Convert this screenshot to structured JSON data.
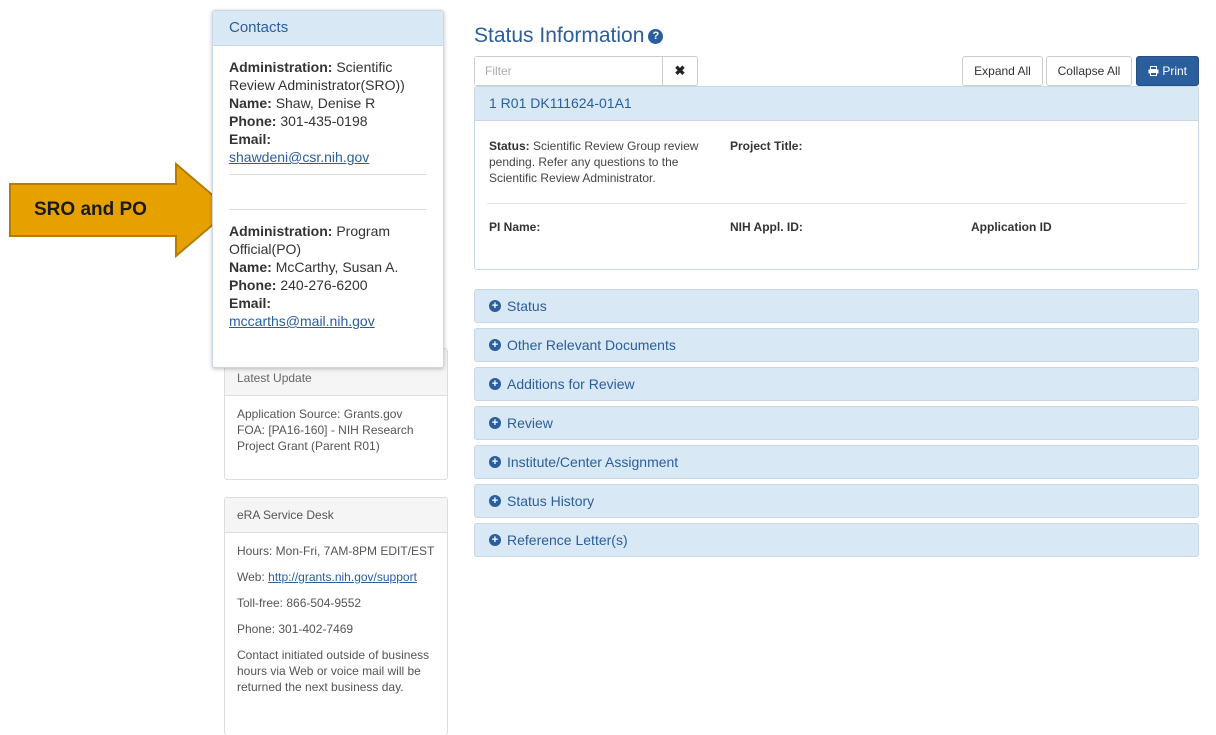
{
  "callout": {
    "label": "SRO and PO",
    "color": "#e6a100"
  },
  "contacts": {
    "title": "Contacts",
    "sro": {
      "admin_label": "Administration:",
      "admin_value": "Scientific Review Administrator(SRO))",
      "name_label": "Name:",
      "name_value": "Shaw, Denise R",
      "phone_label": "Phone:",
      "phone_value": "301-435-0198",
      "email_label": "Email:",
      "email_value": "shawdeni@csr.nih.gov"
    },
    "po": {
      "admin_label": "Administration:",
      "admin_value": "Program Official(PO)",
      "name_label": "Name:",
      "name_value": "McCarthy, Susan A.",
      "phone_label": "Phone:",
      "phone_value": "240-276-6200",
      "email_label": "Email:",
      "email_value": "mccarths@mail.nih.gov"
    }
  },
  "latest_update": {
    "title": "Latest Update",
    "source": "Application Source: Grants.gov",
    "foa": "FOA: [PA16-160] -  NIH Research Project Grant (Parent R01)"
  },
  "service_desk": {
    "title": "eRA Service Desk",
    "hours": "Hours: Mon-Fri, 7AM-8PM EDIT/EST",
    "web_label": "Web:",
    "web_link": "http://grants.nih.gov/support",
    "toll_free": "Toll-free: 866-504-9552",
    "phone": "Phone: 301-402-7469",
    "note": "Contact initiated outside of business hours via Web or voice mail will be returned the next business day."
  },
  "main": {
    "title": "Status Information",
    "filter_placeholder": "Filter",
    "clear_glyph": "✖",
    "expand_all": "Expand All",
    "collapse_all": "Collapse All",
    "print": "Print",
    "application": {
      "id": "1 R01 DK111624-01A1",
      "status_label": "Status:",
      "status_value": "Scientific Review Group review pending. Refer any questions to the Scientific Review Administrator.",
      "project_title_label": "Project Title:",
      "pi_name_label": "PI Name:",
      "nih_appl_id_label": "NIH Appl. ID:",
      "application_id_label": "Application ID"
    },
    "sections": [
      "Status",
      "Other Relevant Documents",
      "Additions for Review",
      "Review",
      "Institute/Center Assignment",
      "Status History",
      "Reference Letter(s)"
    ]
  },
  "colors": {
    "accent": "#2a5e9c",
    "panel_header": "#d9e8f5",
    "arrow": "#e6a100"
  }
}
